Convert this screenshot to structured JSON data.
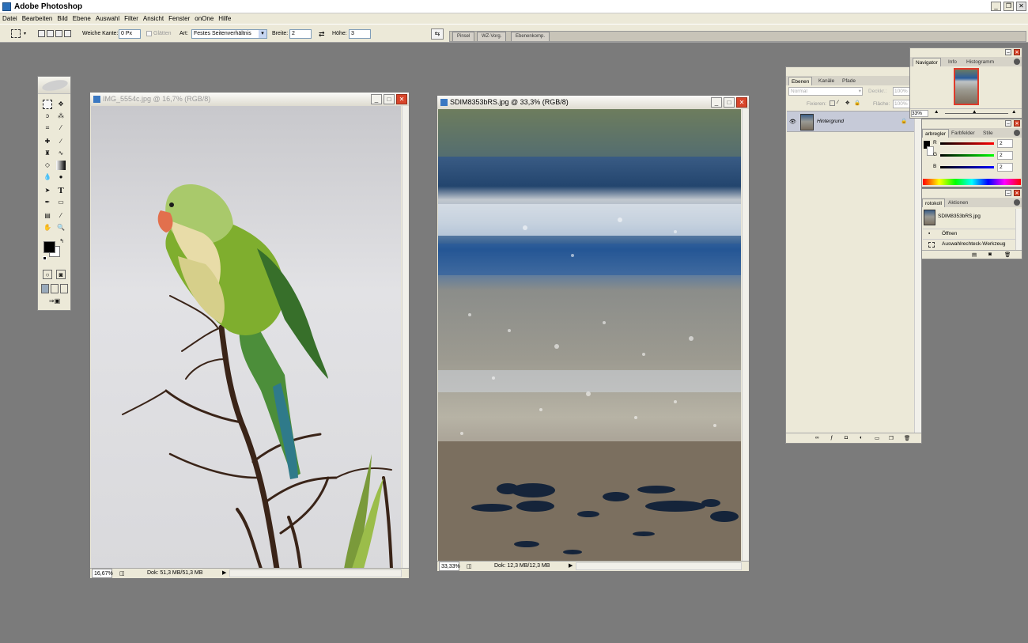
{
  "app": {
    "title": "Adobe Photoshop",
    "minimize": "_",
    "maximize": "❐",
    "close": "✕"
  },
  "menu": [
    "Datei",
    "Bearbeiten",
    "Bild",
    "Ebene",
    "Auswahl",
    "Filter",
    "Ansicht",
    "Fenster",
    "onOne",
    "Hilfe"
  ],
  "options": {
    "feather_label": "Weiche Kante:",
    "feather_value": "0 Px",
    "antialias_label": "Glätten",
    "style_label": "Art:",
    "style_value": "Festes Seitenverhältnis",
    "width_label": "Breite:",
    "width_value": "2",
    "height_label": "Höhe:",
    "height_value": "3",
    "well_tabs": [
      "Pinsel",
      "WZ-Vorg.",
      "Ebenenkomp."
    ]
  },
  "doc1": {
    "title": "IMG_5554c.jpg @ 16,7% (RGB/8)",
    "zoom": "16,67%",
    "doc_size": "Dok: 51,3 MB/51,3 MB"
  },
  "doc2": {
    "title": "SDIM8353bRS.jpg @ 33,3% (RGB/8)",
    "zoom": "33,33%",
    "doc_size": "Dok: 12,3 MB/12,3 MB"
  },
  "layers": {
    "tabs": [
      "Ebenen",
      "Kanäle",
      "Pfade"
    ],
    "blend_mode": "Normal",
    "opacity_label": "Deckkr.:",
    "opacity_value": "100%",
    "lock_label": "Fixieren:",
    "fill_label": "Fläche:",
    "fill_value": "100%",
    "layer_name": "Hintergrund"
  },
  "navigator": {
    "tabs": [
      "Navigator",
      "Info",
      "Histogramm"
    ],
    "zoom": "33%"
  },
  "color": {
    "tabs": [
      "arbregler",
      "Farbfelder",
      "Stile"
    ],
    "r_label": "R",
    "g_label": "G",
    "b_label": "B",
    "r": "2",
    "g": "2",
    "b": "2"
  },
  "history": {
    "tabs": [
      "rotokoll",
      "Aktionen"
    ],
    "snapshot": "SDIM8353bRS.jpg",
    "steps": [
      "Öffnen",
      "Auswahlrechteck-Werkzeug"
    ]
  }
}
